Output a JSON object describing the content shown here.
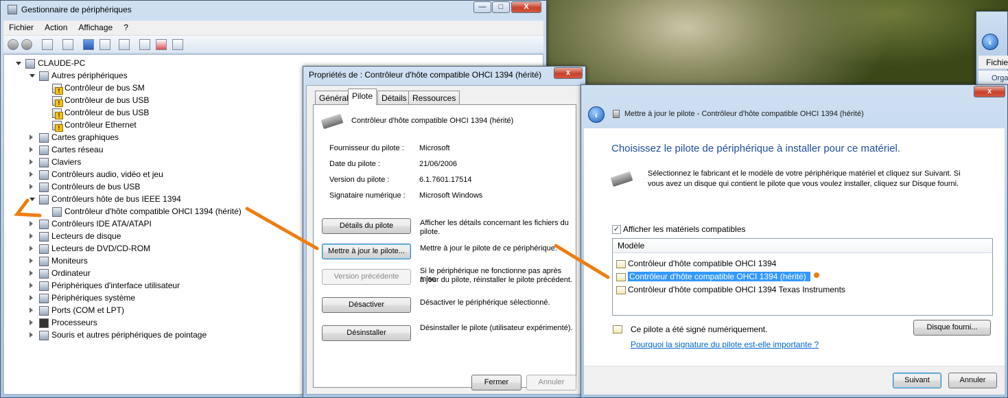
{
  "device_manager": {
    "title": "Gestionnaire de périphériques",
    "menu": [
      "Fichier",
      "Action",
      "Affichage",
      "?"
    ],
    "window_buttons": [
      "—",
      "□",
      "X"
    ],
    "tree": [
      {
        "label": "CLAUDE-PC",
        "icon": "computer-icon"
      },
      {
        "label": "Autres périphériques",
        "icon": "unknown-device-icon"
      },
      {
        "label": "Contrôleur de bus SM",
        "icon": "warning-device-icon"
      },
      {
        "label": "Contrôleur de bus USB",
        "icon": "warning-device-icon"
      },
      {
        "label": "Contrôleur de bus USB",
        "icon": "warning-device-icon"
      },
      {
        "label": "Contrôleur Ethernet",
        "icon": "warning-device-icon"
      },
      {
        "label": "Cartes graphiques",
        "icon": "display-adapter-icon"
      },
      {
        "label": "Cartes réseau",
        "icon": "network-icon"
      },
      {
        "label": "Claviers",
        "icon": "keyboard-icon"
      },
      {
        "label": "Contrôleurs audio, vidéo et jeu",
        "icon": "audio-icon"
      },
      {
        "label": "Contrôleurs de bus USB",
        "icon": "usb-icon"
      },
      {
        "label": "Contrôleurs hôte de bus IEEE 1394",
        "icon": "firewire-icon"
      },
      {
        "label": "Contrôleur d'hôte compatible OHCI 1394 (hérité)",
        "icon": "firewire-icon"
      },
      {
        "label": "Contrôleurs IDE ATA/ATAPI",
        "icon": "ide-icon"
      },
      {
        "label": "Lecteurs de disque",
        "icon": "disk-icon"
      },
      {
        "label": "Lecteurs de DVD/CD-ROM",
        "icon": "dvd-icon"
      },
      {
        "label": "Moniteurs",
        "icon": "monitor-icon"
      },
      {
        "label": "Ordinateur",
        "icon": "computer-icon"
      },
      {
        "label": "Périphériques d'interface utilisateur",
        "icon": "hid-icon"
      },
      {
        "label": "Périphériques système",
        "icon": "system-icon"
      },
      {
        "label": "Ports (COM et LPT)",
        "icon": "port-icon"
      },
      {
        "label": "Processeurs",
        "icon": "cpu-icon"
      },
      {
        "label": "Souris et autres périphériques de pointage",
        "icon": "mouse-icon"
      }
    ]
  },
  "properties": {
    "title": "Propriétés de : Contrôleur d'hôte compatible OHCI 1394 (hérité)",
    "close": "x",
    "tabs": [
      "Général",
      "Pilote",
      "Détails",
      "Ressources"
    ],
    "device_name": "Contrôleur d'hôte compatible OHCI 1394 (hérité)",
    "fields": [
      {
        "label": "Fournisseur du pilote :",
        "value": "Microsoft"
      },
      {
        "label": "Date du pilote :",
        "value": "21/06/2006"
      },
      {
        "label": "Version du pilote :",
        "value": "6.1.7601.17514"
      },
      {
        "label": "Signataire numérique :",
        "value": "Microsoft Windows"
      }
    ],
    "actions": [
      {
        "button": "Détails du pilote",
        "desc1": "Afficher les détails concernant les fichiers du",
        "desc2": "pilote."
      },
      {
        "button": "Mettre à jour le pilote...",
        "desc1": "Mettre à jour le pilote de ce périphérique.",
        "desc2": ""
      },
      {
        "button": "Version précédente",
        "desc1": "Si le périphérique ne fonctionne pas après mise",
        "desc2": "à jour du pilote, réinstaller le pilote précédent."
      },
      {
        "button": "Désactiver",
        "desc1": "Désactiver le périphérique sélectionné.",
        "desc2": ""
      },
      {
        "button": "Désinstaller",
        "desc1": "Désinstaller le pilote (utilisateur expérimenté).",
        "desc2": ""
      }
    ],
    "ok": "Fermer",
    "cancel": "Annuler"
  },
  "update": {
    "title": "Mettre à jour le pilote - Contrôleur d'hôte compatible OHCI 1394 (hérité)",
    "close": "x",
    "heading": "Choisissez le pilote de périphérique à installer pour ce matériel.",
    "intro1": "Sélectionnez le fabricant et le modèle de votre périphérique matériel et cliquez sur Suivant. Si",
    "intro2": "vous avez un disque qui contient le pilote que vous voulez installer, cliquez sur Disque fourni.",
    "show_compatible": "Afficher les matériels compatibles",
    "list_header": "Modèle",
    "models": [
      "Contrôleur d'hôte compatible OHCI 1394",
      "Contrôleur d'hôte compatible OHCI 1394 (hérité)",
      "Contrôleur d'hôte compatible OHCI 1394 Texas Instruments"
    ],
    "signed": "Ce pilote a été signé numériquement.",
    "why_link": "Pourquoi la signature du pilote est-elle importante ?",
    "have_disk": "Disque fourni...",
    "next": "Suivant",
    "cancel": "Annuler"
  },
  "explorer": {
    "menu_item": "Fichie",
    "toolbar_item": "Orga"
  },
  "colors": {
    "annotation": "#ef7d12",
    "link": "#0066cc",
    "heading": "#1f4ea0",
    "selection": "#3399ff"
  }
}
